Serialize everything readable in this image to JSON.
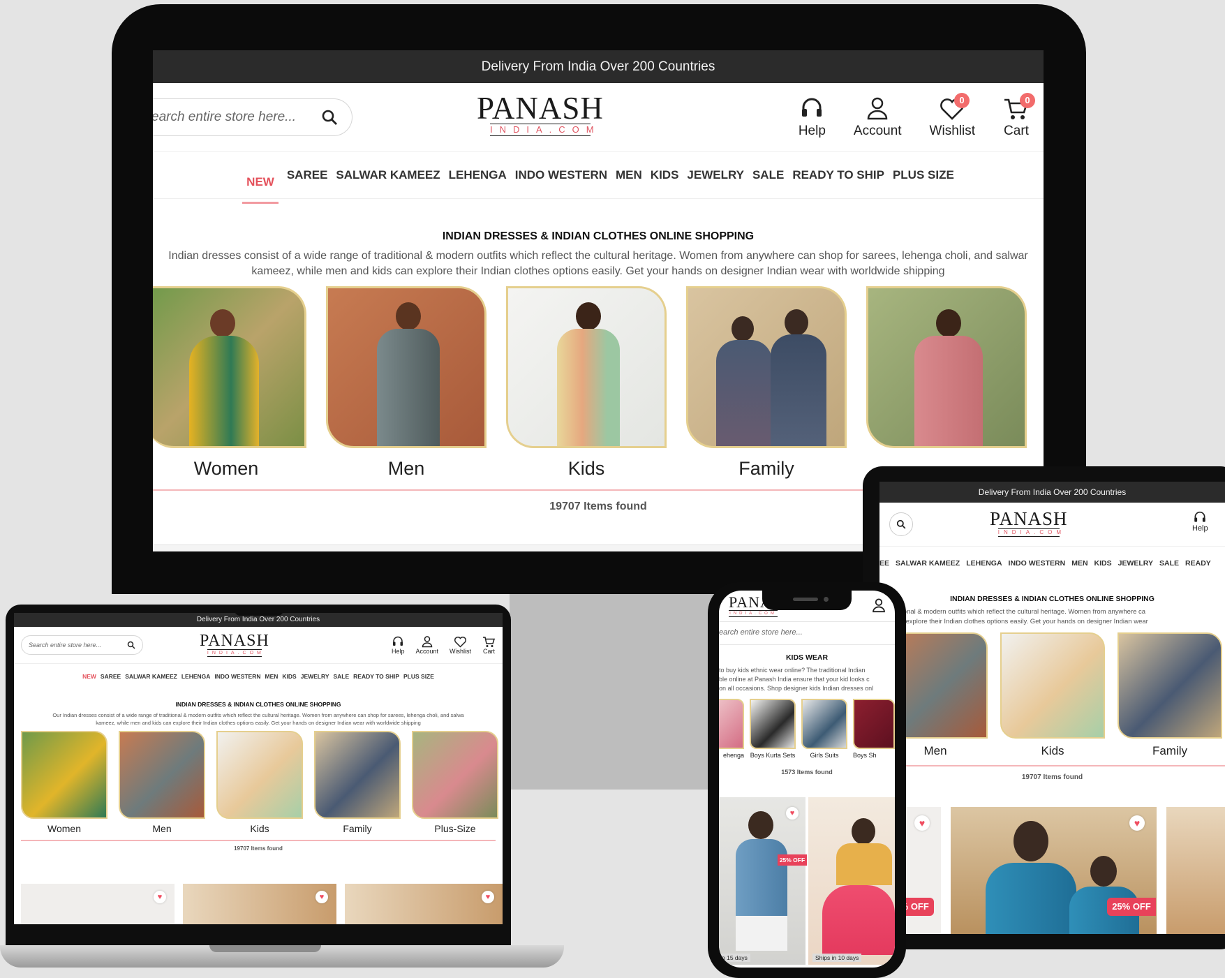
{
  "site": {
    "announcement": "Delivery From India Over 200 Countries",
    "logo_main": "PANASH",
    "logo_sub": "INDIA.COM",
    "search_placeholder_desktop": "earch entire store here...",
    "search_placeholder_laptop": "Search entire store here...",
    "search_placeholder_phone": "earch entire store here...",
    "header_icons": [
      {
        "name": "help-icon",
        "label": "Help"
      },
      {
        "name": "account-icon",
        "label": "Account"
      },
      {
        "name": "wishlist-icon",
        "label": "Wishlist",
        "badge": "0"
      },
      {
        "name": "cart-icon",
        "label": "Cart",
        "badge": "0"
      }
    ],
    "nav_items": [
      "NEW",
      "SAREE",
      "SALWAR KAMEEZ",
      "LEHENGA",
      "INDO WESTERN",
      "MEN",
      "KIDS",
      "JEWELRY",
      "SALE",
      "READY TO SHIP",
      "PLUS SIZE"
    ],
    "tablet_nav_items": [
      "EE",
      "SALWAR KAMEEZ",
      "LEHENGA",
      "INDO WESTERN",
      "MEN",
      "KIDS",
      "JEWELRY",
      "SALE",
      "READY"
    ],
    "intro_title": "INDIAN DRESSES & INDIAN CLOTHES ONLINE SHOPPING",
    "intro_line1": "Indian dresses consist of a wide range of traditional & modern outfits which reflect the cultural heritage. Women from anywhere can shop for sarees, lehenga choli, and salwar",
    "intro_line2": "kameez, while men and kids can explore their Indian clothes options easily. Get your hands on designer Indian wear with worldwide shipping",
    "laptop_intro_line1": "Our Indian dresses consist of a wide range of traditional & modern outfits which reflect the cultural heritage. Women from anywhere can shop for sarees, lehenga choli, and salwa",
    "laptop_intro_line2": "kameez, while men and kids can explore their Indian clothes options easily. Get your hands on designer Indian wear with worldwide shipping",
    "tablet_intro_line1": "of traditional & modern outfits which reflect the cultural heritage. Women from anywhere ca",
    "tablet_intro_line2": "kids can explore their Indian clothes options easily. Get your hands on designer Indian wear",
    "categories": [
      "Women",
      "Men",
      "Kids",
      "Family",
      "Plus-Size"
    ],
    "items_found": "19707 Items found"
  },
  "phone": {
    "section_title": "KIDS WEAR",
    "text_line1": "to buy kids ethnic wear online? The traditional Indian",
    "text_line2": "ble online at Panash India ensure that your kid looks c",
    "text_line3": "on all occasions. Shop designer kids Indian dresses onl",
    "subcats": [
      "ehenga",
      "Boys Kurta Sets",
      "Girls Suits",
      "Boys Sh"
    ],
    "items_found": "1573 Items found",
    "discount": "25% OFF",
    "ship1": "n 15 days",
    "ship2": "Ships in 10 days"
  },
  "tablet": {
    "discount": "25% OFF"
  },
  "colors": {
    "accent": "#e4515b",
    "topbar": "#2b2b2b",
    "frame": "#111111",
    "gold_border": "#e5cf8e"
  }
}
